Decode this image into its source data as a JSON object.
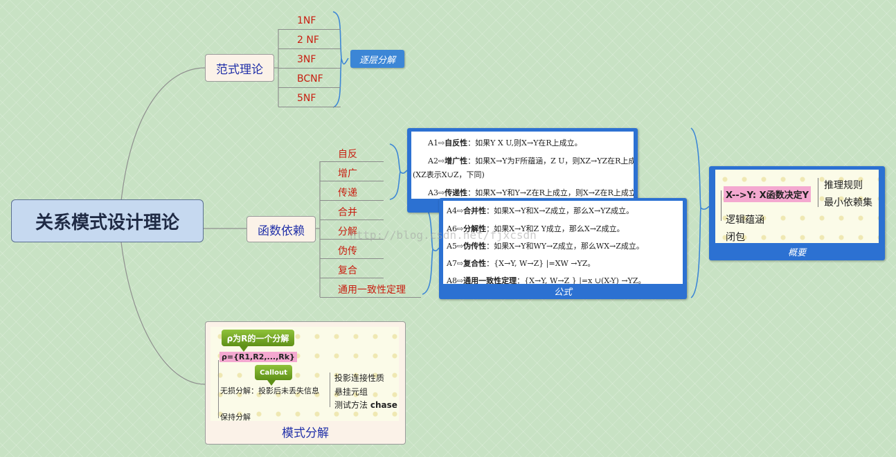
{
  "root": {
    "label": "关系模式设计理论"
  },
  "normal_forms": {
    "label": "范式理论",
    "items": [
      "1NF",
      "2 NF",
      "3NF",
      "BCNF",
      "5NF"
    ],
    "tag": "逐层分解"
  },
  "fd": {
    "label": "函数依赖",
    "items": [
      "自反",
      "增广",
      "传递",
      "合并",
      "分解",
      "伪传",
      "复合",
      "通用一致性定理"
    ]
  },
  "axioms_panel": {
    "a1_prefix": "A1⇨",
    "a1_name": "自反性",
    "a1_text": "：如果Y X U,则X→Y在R上成立。",
    "a2_prefix": "A2⇨",
    "a2_name": "增广性",
    "a2_text": "：如果X→Y为F所蕴涵，Z U，则XZ→YZ在R上成立",
    "a2_cont": "(XZ表示X∪Z，下同)",
    "a3_prefix": "A3⇨",
    "a3_name": "传递性",
    "a3_text": "：如果X→Y和Y→Z在R上成立，则X→Z在R上成立。"
  },
  "formula_panel": {
    "caption": "公式",
    "a4_prefix": "A4⇨",
    "a4_name": "合并性",
    "a4_text": "：如果X→Y和X→Z成立，那么X→YZ成立。",
    "a6_prefix": "A6⇨",
    "a6_name": "分解性",
    "a6_text": "：如果X→Y和Z Y成立，那么X→Z成立。",
    "a5_prefix": "A5⇨",
    "a5_name": "伪传性",
    "a5_text": "：如果X→Y和WY→Z成立，那么WX→Z成立。",
    "a7_prefix": "A7⇨",
    "a7_name": "复合性",
    "a7_text": "：{X→Y,   W→Z} |=XW  →YZ。",
    "a8_prefix": "A8⇨",
    "a8_name": "通用一致性定理",
    "a8_text": "：{X→Y,   W→Z } |=x ∪(X-Y) →YZ。"
  },
  "summary_panel": {
    "caption": "概要",
    "highlight": "X-->Y: X函数决定Y",
    "right_items": [
      "推理规则",
      "最小依赖集"
    ],
    "left_items": [
      "逻辑蕴涵",
      "闭包"
    ]
  },
  "decomposition": {
    "label": "模式分解",
    "callout1": "ρ为R的一个分解",
    "rho": "ρ={R1,R2,...,Rk}",
    "callout2": "Callout",
    "lossless": "无损分解：投影后未丢失信息",
    "sub_items": [
      "投影连接性质",
      "悬挂元组"
    ],
    "test_prefix": "测试方法 ",
    "test_bold": "chase",
    "preserve": "保持分解"
  },
  "watermark": "http://blog.csdn.net/fjxcsdn",
  "colors": {
    "panel": "#2c71d2",
    "leaf_text": "#c81e10",
    "node_text": "#2130a8",
    "root_bg": "#c6d9f0",
    "highlight": "#f4a8d0"
  }
}
